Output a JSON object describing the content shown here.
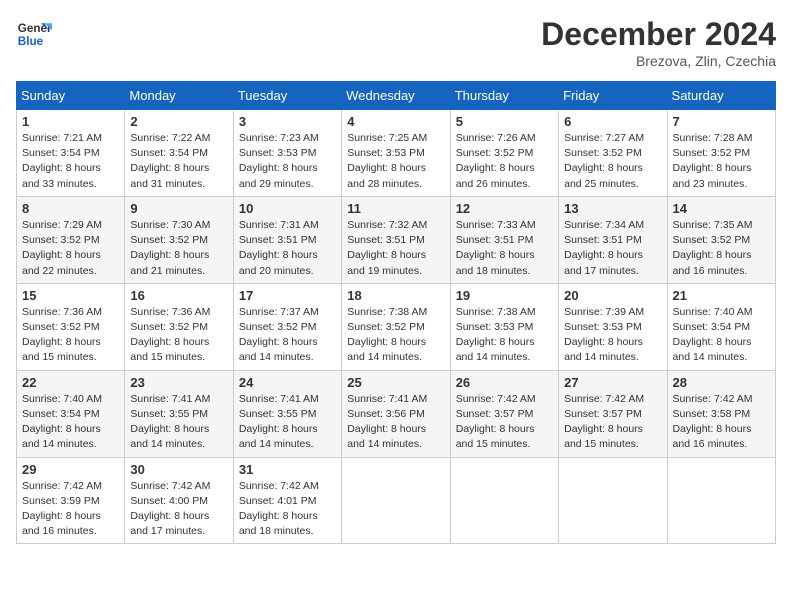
{
  "logo": {
    "line1": "General",
    "line2": "Blue"
  },
  "title": "December 2024",
  "location": "Brezova, Zlin, Czechia",
  "weekdays": [
    "Sunday",
    "Monday",
    "Tuesday",
    "Wednesday",
    "Thursday",
    "Friday",
    "Saturday"
  ],
  "weeks": [
    [
      {
        "day": "1",
        "sunrise": "Sunrise: 7:21 AM",
        "sunset": "Sunset: 3:54 PM",
        "daylight": "Daylight: 8 hours and 33 minutes."
      },
      {
        "day": "2",
        "sunrise": "Sunrise: 7:22 AM",
        "sunset": "Sunset: 3:54 PM",
        "daylight": "Daylight: 8 hours and 31 minutes."
      },
      {
        "day": "3",
        "sunrise": "Sunrise: 7:23 AM",
        "sunset": "Sunset: 3:53 PM",
        "daylight": "Daylight: 8 hours and 29 minutes."
      },
      {
        "day": "4",
        "sunrise": "Sunrise: 7:25 AM",
        "sunset": "Sunset: 3:53 PM",
        "daylight": "Daylight: 8 hours and 28 minutes."
      },
      {
        "day": "5",
        "sunrise": "Sunrise: 7:26 AM",
        "sunset": "Sunset: 3:52 PM",
        "daylight": "Daylight: 8 hours and 26 minutes."
      },
      {
        "day": "6",
        "sunrise": "Sunrise: 7:27 AM",
        "sunset": "Sunset: 3:52 PM",
        "daylight": "Daylight: 8 hours and 25 minutes."
      },
      {
        "day": "7",
        "sunrise": "Sunrise: 7:28 AM",
        "sunset": "Sunset: 3:52 PM",
        "daylight": "Daylight: 8 hours and 23 minutes."
      }
    ],
    [
      {
        "day": "8",
        "sunrise": "Sunrise: 7:29 AM",
        "sunset": "Sunset: 3:52 PM",
        "daylight": "Daylight: 8 hours and 22 minutes."
      },
      {
        "day": "9",
        "sunrise": "Sunrise: 7:30 AM",
        "sunset": "Sunset: 3:52 PM",
        "daylight": "Daylight: 8 hours and 21 minutes."
      },
      {
        "day": "10",
        "sunrise": "Sunrise: 7:31 AM",
        "sunset": "Sunset: 3:51 PM",
        "daylight": "Daylight: 8 hours and 20 minutes."
      },
      {
        "day": "11",
        "sunrise": "Sunrise: 7:32 AM",
        "sunset": "Sunset: 3:51 PM",
        "daylight": "Daylight: 8 hours and 19 minutes."
      },
      {
        "day": "12",
        "sunrise": "Sunrise: 7:33 AM",
        "sunset": "Sunset: 3:51 PM",
        "daylight": "Daylight: 8 hours and 18 minutes."
      },
      {
        "day": "13",
        "sunrise": "Sunrise: 7:34 AM",
        "sunset": "Sunset: 3:51 PM",
        "daylight": "Daylight: 8 hours and 17 minutes."
      },
      {
        "day": "14",
        "sunrise": "Sunrise: 7:35 AM",
        "sunset": "Sunset: 3:52 PM",
        "daylight": "Daylight: 8 hours and 16 minutes."
      }
    ],
    [
      {
        "day": "15",
        "sunrise": "Sunrise: 7:36 AM",
        "sunset": "Sunset: 3:52 PM",
        "daylight": "Daylight: 8 hours and 15 minutes."
      },
      {
        "day": "16",
        "sunrise": "Sunrise: 7:36 AM",
        "sunset": "Sunset: 3:52 PM",
        "daylight": "Daylight: 8 hours and 15 minutes."
      },
      {
        "day": "17",
        "sunrise": "Sunrise: 7:37 AM",
        "sunset": "Sunset: 3:52 PM",
        "daylight": "Daylight: 8 hours and 14 minutes."
      },
      {
        "day": "18",
        "sunrise": "Sunrise: 7:38 AM",
        "sunset": "Sunset: 3:52 PM",
        "daylight": "Daylight: 8 hours and 14 minutes."
      },
      {
        "day": "19",
        "sunrise": "Sunrise: 7:38 AM",
        "sunset": "Sunset: 3:53 PM",
        "daylight": "Daylight: 8 hours and 14 minutes."
      },
      {
        "day": "20",
        "sunrise": "Sunrise: 7:39 AM",
        "sunset": "Sunset: 3:53 PM",
        "daylight": "Daylight: 8 hours and 14 minutes."
      },
      {
        "day": "21",
        "sunrise": "Sunrise: 7:40 AM",
        "sunset": "Sunset: 3:54 PM",
        "daylight": "Daylight: 8 hours and 14 minutes."
      }
    ],
    [
      {
        "day": "22",
        "sunrise": "Sunrise: 7:40 AM",
        "sunset": "Sunset: 3:54 PM",
        "daylight": "Daylight: 8 hours and 14 minutes."
      },
      {
        "day": "23",
        "sunrise": "Sunrise: 7:41 AM",
        "sunset": "Sunset: 3:55 PM",
        "daylight": "Daylight: 8 hours and 14 minutes."
      },
      {
        "day": "24",
        "sunrise": "Sunrise: 7:41 AM",
        "sunset": "Sunset: 3:55 PM",
        "daylight": "Daylight: 8 hours and 14 minutes."
      },
      {
        "day": "25",
        "sunrise": "Sunrise: 7:41 AM",
        "sunset": "Sunset: 3:56 PM",
        "daylight": "Daylight: 8 hours and 14 minutes."
      },
      {
        "day": "26",
        "sunrise": "Sunrise: 7:42 AM",
        "sunset": "Sunset: 3:57 PM",
        "daylight": "Daylight: 8 hours and 15 minutes."
      },
      {
        "day": "27",
        "sunrise": "Sunrise: 7:42 AM",
        "sunset": "Sunset: 3:57 PM",
        "daylight": "Daylight: 8 hours and 15 minutes."
      },
      {
        "day": "28",
        "sunrise": "Sunrise: 7:42 AM",
        "sunset": "Sunset: 3:58 PM",
        "daylight": "Daylight: 8 hours and 16 minutes."
      }
    ],
    [
      {
        "day": "29",
        "sunrise": "Sunrise: 7:42 AM",
        "sunset": "Sunset: 3:59 PM",
        "daylight": "Daylight: 8 hours and 16 minutes."
      },
      {
        "day": "30",
        "sunrise": "Sunrise: 7:42 AM",
        "sunset": "Sunset: 4:00 PM",
        "daylight": "Daylight: 8 hours and 17 minutes."
      },
      {
        "day": "31",
        "sunrise": "Sunrise: 7:42 AM",
        "sunset": "Sunset: 4:01 PM",
        "daylight": "Daylight: 8 hours and 18 minutes."
      },
      null,
      null,
      null,
      null
    ]
  ]
}
